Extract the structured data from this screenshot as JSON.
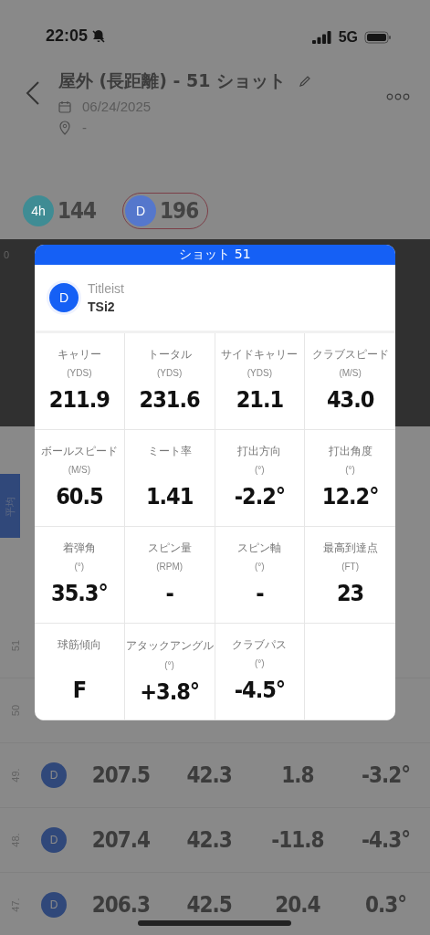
{
  "status_bar": {
    "time": "22:05",
    "network": "5G"
  },
  "header": {
    "title": "屋外 (長距離) - 51 ショット",
    "date": "06/24/2025",
    "location": "-"
  },
  "clubs": [
    {
      "label": "4h",
      "distance": "144",
      "selected": false,
      "color": "#3f8c94"
    },
    {
      "label": "D",
      "distance": "196",
      "selected": true,
      "color": "#5577cc"
    }
  ],
  "chart": {
    "axis_label": "0"
  },
  "average_tab": {
    "label": "平均"
  },
  "rows": [
    {
      "index": "51"
    },
    {
      "index": "50"
    },
    {
      "index": "49.",
      "club": "D",
      "values": [
        "207.5",
        "42.3",
        "1.8",
        "-3.2°"
      ]
    },
    {
      "index": "48.",
      "club": "D",
      "values": [
        "207.4",
        "42.3",
        "-11.8",
        "-4.3°"
      ]
    },
    {
      "index": "47.",
      "club": "D",
      "values": [
        "206.3",
        "42.5",
        "20.4",
        "0.3°"
      ]
    }
  ],
  "modal": {
    "title": "ショット 51",
    "club": {
      "badge": "D",
      "brand": "Titleist",
      "model": "TSi2"
    },
    "metrics": [
      {
        "label": "キャリー",
        "unit": "(YDS)",
        "value": "211.9"
      },
      {
        "label": "トータル",
        "unit": "(YDS)",
        "value": "231.6"
      },
      {
        "label": "サイドキャリー",
        "unit": "(YDS)",
        "value": "21.1"
      },
      {
        "label": "クラブスピード",
        "unit": "(M/S)",
        "value": "43.0"
      },
      {
        "label": "ボールスピード",
        "unit": "(M/S)",
        "value": "60.5"
      },
      {
        "label": "ミート率",
        "value": "1.41"
      },
      {
        "label": "打出方向",
        "unit": "(°)",
        "value": "-2.2°"
      },
      {
        "label": "打出角度",
        "unit": "(°)",
        "value": "12.2°"
      },
      {
        "label": "着弾角",
        "unit": "(°)",
        "value": "35.3°"
      },
      {
        "label": "スピン量",
        "unit": "(RPM)",
        "value": "-"
      },
      {
        "label": "スピン軸",
        "unit": "(°)",
        "value": "-"
      },
      {
        "label": "最高到達点",
        "unit": "(FT)",
        "value": "23"
      },
      {
        "label": "球筋傾向",
        "value": "F"
      },
      {
        "label": "アタックアングル",
        "unit": "(°)",
        "value": "+3.8°"
      },
      {
        "label": "クラブパス",
        "unit": "(°)",
        "value": "-4.5°"
      }
    ]
  }
}
